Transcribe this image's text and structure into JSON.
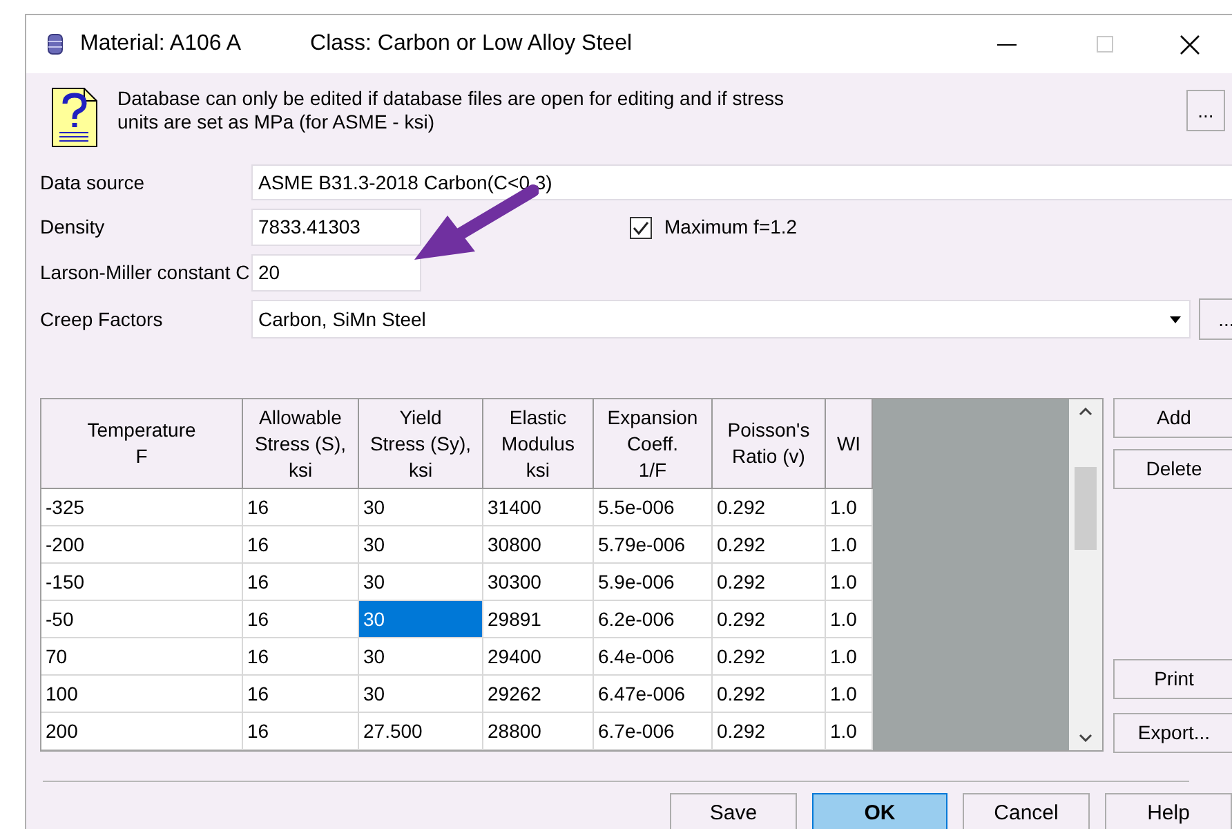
{
  "window": {
    "title": "Material: A106 A",
    "subtitle": "Class: Carbon or Low Alloy Steel"
  },
  "notice": {
    "text": "Database can only be edited if database files are open for editing and if stress units are set as MPa (for ASME - ksi)",
    "button": "..."
  },
  "fields": {
    "data_source": {
      "label": "Data source",
      "value": "ASME B31.3-2018 Carbon(C<0.3)"
    },
    "density": {
      "label": "Density",
      "value": "7833.41303"
    },
    "max_f": {
      "label": "Maximum f=1.2",
      "checked": true
    },
    "larson_miller": {
      "label": "Larson-Miller constant C",
      "value": "20"
    },
    "creep_factors": {
      "label": "Creep Factors",
      "value": "Carbon, SiMn Steel",
      "button": "..."
    }
  },
  "table": {
    "columns": [
      "Temperature\nF",
      "Allowable\nStress (S),\nksi",
      "Yield\nStress (Sy),\nksi",
      "Elastic\nModulus\nksi",
      "Expansion\nCoeff.\n1/F",
      "Poisson's\nRatio (v)",
      "WI"
    ],
    "rows": [
      {
        "cells": [
          {
            "text": "-325",
            "selected": false
          },
          {
            "text": "16",
            "selected": false
          },
          {
            "text": "30",
            "selected": false
          },
          {
            "text": "31400",
            "selected": false
          },
          {
            "text": "5.5e-006",
            "selected": false
          },
          {
            "text": "0.292",
            "selected": false
          },
          {
            "text": "1.0",
            "selected": false
          }
        ]
      },
      {
        "cells": [
          {
            "text": "-200",
            "selected": false
          },
          {
            "text": "16",
            "selected": false
          },
          {
            "text": "30",
            "selected": false
          },
          {
            "text": "30800",
            "selected": false
          },
          {
            "text": "5.79e-006",
            "selected": false
          },
          {
            "text": "0.292",
            "selected": false
          },
          {
            "text": "1.0",
            "selected": false
          }
        ]
      },
      {
        "cells": [
          {
            "text": "-150",
            "selected": false
          },
          {
            "text": "16",
            "selected": false
          },
          {
            "text": "30",
            "selected": false
          },
          {
            "text": "30300",
            "selected": false
          },
          {
            "text": "5.9e-006",
            "selected": false
          },
          {
            "text": "0.292",
            "selected": false
          },
          {
            "text": "1.0",
            "selected": false
          }
        ]
      },
      {
        "cells": [
          {
            "text": "-50",
            "selected": false
          },
          {
            "text": "16",
            "selected": false
          },
          {
            "text": "30",
            "selected": true
          },
          {
            "text": "29891",
            "selected": false
          },
          {
            "text": "6.2e-006",
            "selected": false
          },
          {
            "text": "0.292",
            "selected": false
          },
          {
            "text": "1.0",
            "selected": false
          }
        ]
      },
      {
        "cells": [
          {
            "text": "70",
            "selected": false
          },
          {
            "text": "16",
            "selected": false
          },
          {
            "text": "30",
            "selected": false
          },
          {
            "text": "29400",
            "selected": false
          },
          {
            "text": "6.4e-006",
            "selected": false
          },
          {
            "text": "0.292",
            "selected": false
          },
          {
            "text": "1.0",
            "selected": false
          }
        ]
      },
      {
        "cells": [
          {
            "text": "100",
            "selected": false
          },
          {
            "text": "16",
            "selected": false
          },
          {
            "text": "30",
            "selected": false
          },
          {
            "text": "29262",
            "selected": false
          },
          {
            "text": "6.47e-006",
            "selected": false
          },
          {
            "text": "0.292",
            "selected": false
          },
          {
            "text": "1.0",
            "selected": false
          }
        ]
      },
      {
        "cells": [
          {
            "text": "200",
            "selected": false
          },
          {
            "text": "16",
            "selected": false
          },
          {
            "text": "27.500",
            "selected": false
          },
          {
            "text": "28800",
            "selected": false
          },
          {
            "text": "6.7e-006",
            "selected": false
          },
          {
            "text": "0.292",
            "selected": false
          },
          {
            "text": "1.0",
            "selected": false
          }
        ]
      }
    ]
  },
  "side_buttons": {
    "top": [
      "Add",
      "Delete"
    ],
    "bottom": [
      "Print",
      "Export..."
    ]
  },
  "buttons": [
    {
      "label": "Save",
      "default": false
    },
    {
      "label": "OK",
      "default": true
    },
    {
      "label": "Cancel",
      "default": false
    },
    {
      "label": "Help",
      "default": false
    }
  ]
}
